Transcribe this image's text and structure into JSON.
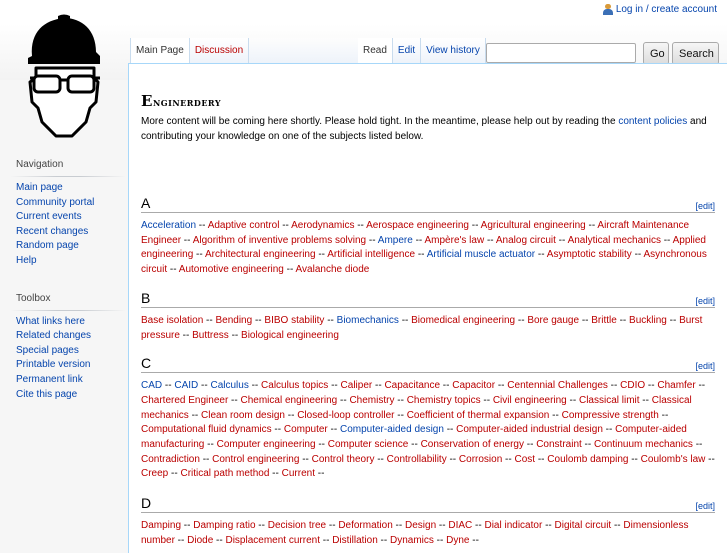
{
  "header": {
    "personal_link": "Log in / create account",
    "user_icon": "user-icon"
  },
  "logo": {
    "icon": "engineer-hardhat-logo"
  },
  "tabs": {
    "namespaces": [
      {
        "label": "Main Page",
        "selected": true
      },
      {
        "label": "Discussion",
        "selected": false
      }
    ],
    "views": [
      {
        "label": "Read",
        "selected": true
      },
      {
        "label": "Edit",
        "selected": false
      },
      {
        "label": "View history",
        "selected": false
      }
    ]
  },
  "search": {
    "value": "",
    "placeholder": "",
    "go_label": "Go",
    "search_label": "Search"
  },
  "sidebar": {
    "navigation": {
      "heading": "Navigation",
      "items": [
        "Main page",
        "Community portal",
        "Current events",
        "Recent changes",
        "Random page",
        "Help"
      ]
    },
    "toolbox": {
      "heading": "Toolbox",
      "items": [
        "What links here",
        "Related changes",
        "Special pages",
        "Printable version",
        "Permanent link",
        "Cite this page"
      ]
    }
  },
  "content": {
    "title": "Enginerdery",
    "intro_before": "More content will be coming here shortly. Please hold tight. In the meantime, please help out by reading the ",
    "intro_link": "content policies",
    "intro_after": " and contributing your knowledge on one of the subjects listed below.",
    "edit_label": "[edit]",
    "separator": " -- ",
    "sections": [
      {
        "letter": "A",
        "links": [
          {
            "t": "Acceleration",
            "exists": true
          },
          {
            "t": "Adaptive control",
            "exists": false
          },
          {
            "t": "Aerodynamics",
            "exists": false
          },
          {
            "t": "Aerospace engineering",
            "exists": false
          },
          {
            "t": "Agricultural engineering",
            "exists": false
          },
          {
            "t": "Aircraft Maintenance Engineer",
            "exists": false
          },
          {
            "t": "Algorithm of inventive problems solving",
            "exists": false
          },
          {
            "t": "Ampere",
            "exists": true
          },
          {
            "t": "Ampère's law",
            "exists": false
          },
          {
            "t": "Analog circuit",
            "exists": false
          },
          {
            "t": "Analytical mechanics",
            "exists": false
          },
          {
            "t": "Applied engineering",
            "exists": false
          },
          {
            "t": "Architectural engineering",
            "exists": false
          },
          {
            "t": "Artificial intelligence",
            "exists": false
          },
          {
            "t": "Artificial muscle actuator",
            "exists": true
          },
          {
            "t": "Asymptotic stability",
            "exists": false
          },
          {
            "t": "Asynchronous circuit",
            "exists": false
          },
          {
            "t": "Automotive engineering",
            "exists": false
          },
          {
            "t": "Avalanche diode",
            "exists": false
          }
        ],
        "trailing": false
      },
      {
        "letter": "B",
        "links": [
          {
            "t": "Base isolation",
            "exists": false
          },
          {
            "t": "Bending",
            "exists": false
          },
          {
            "t": "BIBO stability",
            "exists": false
          },
          {
            "t": "Biomechanics",
            "exists": true
          },
          {
            "t": "Biomedical engineering",
            "exists": false
          },
          {
            "t": "Bore gauge",
            "exists": false
          },
          {
            "t": "Brittle",
            "exists": false
          },
          {
            "t": "Buckling",
            "exists": false
          },
          {
            "t": "Burst pressure",
            "exists": false
          },
          {
            "t": "Buttress",
            "exists": false
          },
          {
            "t": "Biological engineering",
            "exists": false
          }
        ],
        "trailing": false
      },
      {
        "letter": "C",
        "links": [
          {
            "t": "CAD",
            "exists": true
          },
          {
            "t": "CAID",
            "exists": true
          },
          {
            "t": "Calculus",
            "exists": true
          },
          {
            "t": "Calculus topics",
            "exists": false
          },
          {
            "t": "Caliper",
            "exists": false
          },
          {
            "t": "Capacitance",
            "exists": false
          },
          {
            "t": "Capacitor",
            "exists": false
          },
          {
            "t": "Centennial Challenges",
            "exists": false
          },
          {
            "t": "CDIO",
            "exists": false
          },
          {
            "t": "Chamfer",
            "exists": false
          },
          {
            "t": "Chartered Engineer",
            "exists": false
          },
          {
            "t": "Chemical engineering",
            "exists": false
          },
          {
            "t": "Chemistry",
            "exists": false
          },
          {
            "t": "Chemistry topics",
            "exists": false
          },
          {
            "t": "Civil engineering",
            "exists": false
          },
          {
            "t": "Classical limit",
            "exists": false
          },
          {
            "t": "Classical mechanics",
            "exists": false
          },
          {
            "t": "Clean room design",
            "exists": false
          },
          {
            "t": "Closed-loop controller",
            "exists": false
          },
          {
            "t": "Coefficient of thermal expansion",
            "exists": false
          },
          {
            "t": "Compressive strength",
            "exists": false
          },
          {
            "t": "Computational fluid dynamics",
            "exists": false
          },
          {
            "t": "Computer",
            "exists": false
          },
          {
            "t": "Computer-aided design",
            "exists": true
          },
          {
            "t": "Computer-aided industrial design",
            "exists": false
          },
          {
            "t": "Computer-aided manufacturing",
            "exists": false
          },
          {
            "t": "Computer engineering",
            "exists": false
          },
          {
            "t": "Computer science",
            "exists": false
          },
          {
            "t": "Conservation of energy",
            "exists": false
          },
          {
            "t": "Constraint",
            "exists": false
          },
          {
            "t": "Continuum mechanics",
            "exists": false
          },
          {
            "t": "Contradiction",
            "exists": false
          },
          {
            "t": "Control engineering",
            "exists": false
          },
          {
            "t": "Control theory",
            "exists": false
          },
          {
            "t": "Controllability",
            "exists": false
          },
          {
            "t": "Corrosion",
            "exists": false
          },
          {
            "t": "Cost",
            "exists": false
          },
          {
            "t": "Coulomb damping",
            "exists": false
          },
          {
            "t": "Coulomb's law",
            "exists": false
          },
          {
            "t": "Creep",
            "exists": false
          },
          {
            "t": "Critical path method",
            "exists": false
          },
          {
            "t": "Current",
            "exists": false
          }
        ],
        "trailing": true
      },
      {
        "letter": "D",
        "links": [
          {
            "t": "Damping",
            "exists": false
          },
          {
            "t": "Damping ratio",
            "exists": false
          },
          {
            "t": "Decision tree",
            "exists": false
          },
          {
            "t": "Deformation",
            "exists": false
          },
          {
            "t": "Design",
            "exists": false
          },
          {
            "t": "DIAC",
            "exists": false
          },
          {
            "t": "Dial indicator",
            "exists": false
          },
          {
            "t": "Digital circuit",
            "exists": false
          },
          {
            "t": "Dimensionless number",
            "exists": false
          },
          {
            "t": "Diode",
            "exists": false
          },
          {
            "t": "Displacement current",
            "exists": false
          },
          {
            "t": "Distillation",
            "exists": false
          },
          {
            "t": "Dynamics",
            "exists": false
          },
          {
            "t": "Dyne",
            "exists": false
          }
        ],
        "trailing": true
      }
    ]
  },
  "colors": {
    "link_existing": "#0645ad",
    "link_missing": "#ba0000",
    "content_border": "#a7d7f9"
  }
}
